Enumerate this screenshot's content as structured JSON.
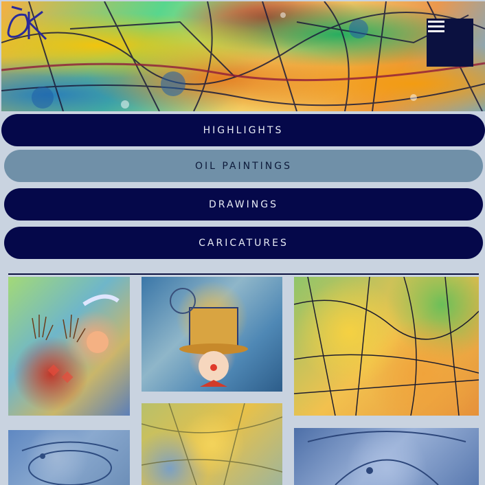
{
  "site": {
    "logo": "logo-mark",
    "menu_icon": "hamburger-icon"
  },
  "nav": {
    "items": [
      {
        "label": "HIGHLIGHTS",
        "active": false
      },
      {
        "label": "OIL PAINTINGS",
        "active": true
      },
      {
        "label": "DRAWINGS",
        "active": false
      },
      {
        "label": "CARICATURES",
        "active": false
      }
    ]
  },
  "gallery": {
    "images": [
      {
        "subject": "harlequin-hands"
      },
      {
        "subject": "clown-with-top-hat"
      },
      {
        "subject": "abstract-lines-warm"
      },
      {
        "subject": "blue-fish-abstract"
      },
      {
        "subject": "golden-abstract"
      },
      {
        "subject": "blue-swirl-abstract"
      }
    ]
  },
  "colors": {
    "navy": "#05084a",
    "active_pill": "#7090a8",
    "background": "#c9d3e0"
  }
}
